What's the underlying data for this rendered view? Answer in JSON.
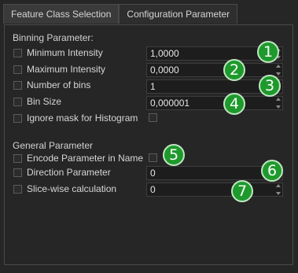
{
  "tabs": [
    {
      "label": "Feature Class Selection"
    },
    {
      "label": "Configuration Parameter"
    }
  ],
  "binning": {
    "title": "Binning Parameter:",
    "min_label": "Minimum Intensity",
    "min_value": "1,0000",
    "max_label": "Maximum Intensity",
    "max_value": "0,0000",
    "bins_label": "Number of bins",
    "bins_value": "1",
    "size_label": "Bin Size",
    "size_value": "0,000001",
    "ignore_label": "Ignore mask for Histogram"
  },
  "general": {
    "title": "General Parameter",
    "encode_label": "Encode Parameter in Name",
    "direction_label": "Direction Parameter",
    "direction_value": "0",
    "slice_label": "Slice-wise calculation",
    "slice_value": "0"
  },
  "badges": [
    "1",
    "2",
    "3",
    "4",
    "5",
    "6",
    "7"
  ],
  "colors": {
    "badge": "#1e9a2c",
    "background": "#262626"
  }
}
